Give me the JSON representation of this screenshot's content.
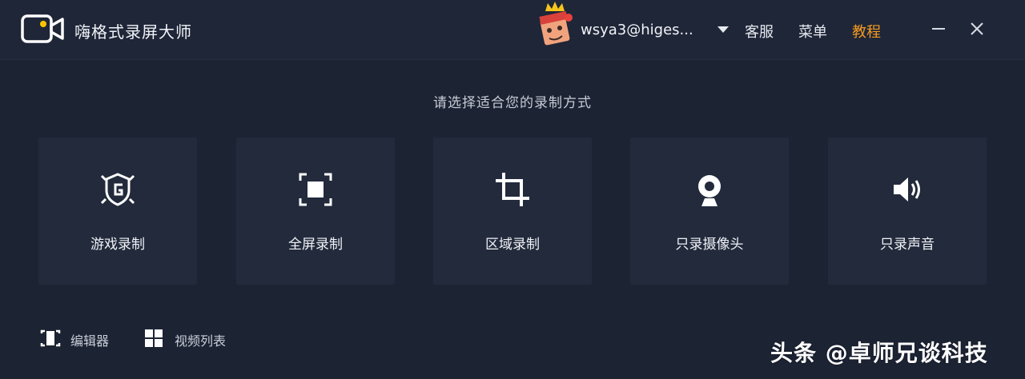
{
  "app": {
    "title": "嗨格式录屏大师"
  },
  "user": {
    "name": "wsya3@higes..."
  },
  "header": {
    "support_label": "客服",
    "menu_label": "菜单",
    "tutorial_label": "教程"
  },
  "prompt": "请选择适合您的录制方式",
  "modes": [
    {
      "label": "游戏录制",
      "icon": "game-shield-icon"
    },
    {
      "label": "全屏录制",
      "icon": "fullscreen-icon"
    },
    {
      "label": "区域录制",
      "icon": "crop-icon"
    },
    {
      "label": "只录摄像头",
      "icon": "webcam-icon"
    },
    {
      "label": "只录声音",
      "icon": "speaker-icon"
    }
  ],
  "bottom": {
    "editor_label": "编辑器",
    "videolist_label": "视频列表"
  },
  "watermark": "头条 @卓师兄谈科技",
  "colors": {
    "background": "#1c2333",
    "card": "#222a3c",
    "accent": "#f49b20",
    "logo": "#ffc400"
  }
}
